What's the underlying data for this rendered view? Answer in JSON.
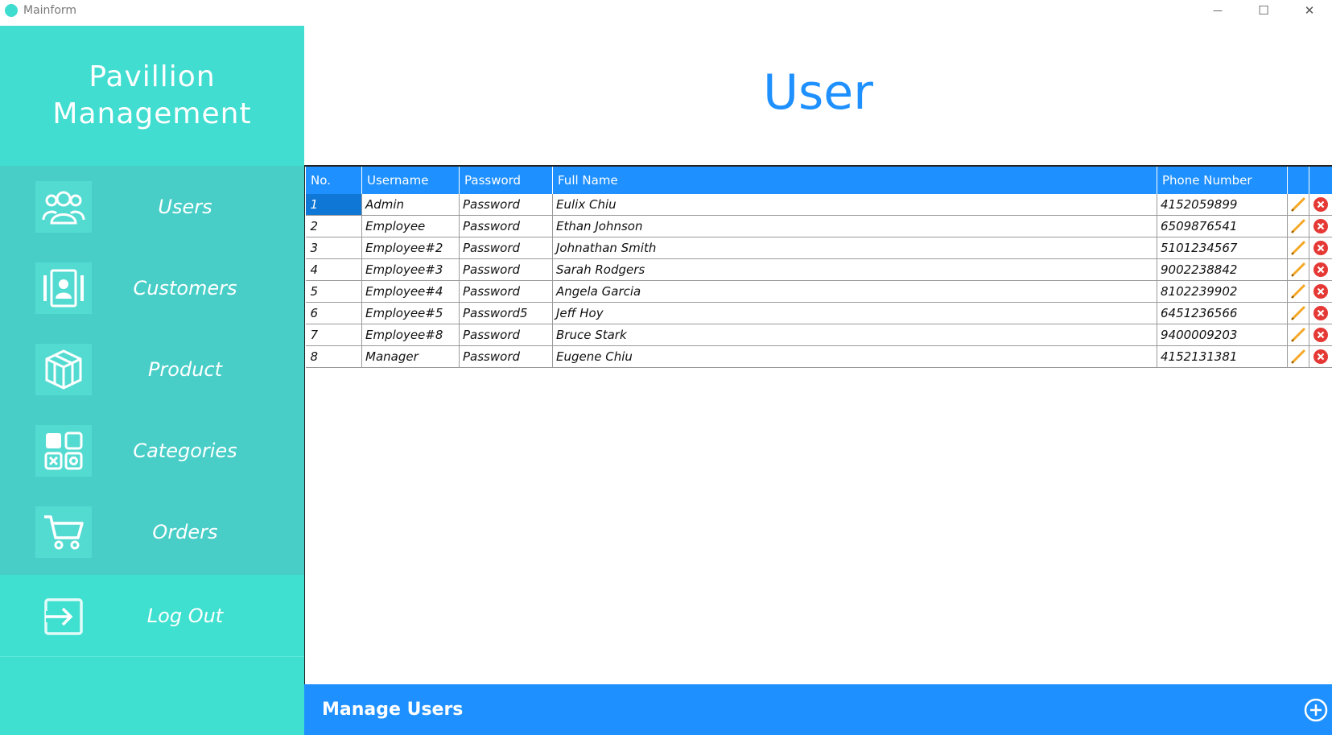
{
  "window": {
    "title": "Mainform",
    "minimize_glyph": "—",
    "maximize_glyph": "☐",
    "close_glyph": "✕"
  },
  "sidebar": {
    "brand_line1": "Pavillion",
    "brand_line2": "Management",
    "items": [
      {
        "label": "Users",
        "icon": "users-icon"
      },
      {
        "label": "Customers",
        "icon": "contact-card-icon"
      },
      {
        "label": "Product",
        "icon": "gift-box-icon"
      },
      {
        "label": "Categories",
        "icon": "categories-icon"
      },
      {
        "label": "Orders",
        "icon": "cart-icon"
      }
    ],
    "logout_label": "Log Out",
    "logout_icon": "logout-icon"
  },
  "main": {
    "title": "User",
    "columns": [
      "No.",
      "Username",
      "Password",
      "Full Name",
      "Phone Number"
    ],
    "rows": [
      {
        "no": "1",
        "username": "Admin",
        "password": "Password",
        "full_name": "Eulix Chiu",
        "phone": "4152059899"
      },
      {
        "no": "2",
        "username": "Employee",
        "password": "Password",
        "full_name": "Ethan Johnson",
        "phone": "6509876541"
      },
      {
        "no": "3",
        "username": "Employee#2",
        "password": "Password",
        "full_name": "Johnathan Smith",
        "phone": "5101234567"
      },
      {
        "no": "4",
        "username": "Employee#3",
        "password": "Password",
        "full_name": "Sarah Rodgers",
        "phone": "9002238842"
      },
      {
        "no": "5",
        "username": "Employee#4",
        "password": "Password",
        "full_name": "Angela Garcia",
        "phone": "8102239902"
      },
      {
        "no": "6",
        "username": "Employee#5",
        "password": "Password5",
        "full_name": "Jeff Hoy",
        "phone": "6451236566"
      },
      {
        "no": "7",
        "username": "Employee#8",
        "password": "Password",
        "full_name": "Bruce Stark",
        "phone": "9400009203"
      },
      {
        "no": "8",
        "username": "Manager",
        "password": "Password",
        "full_name": "Eugene Chiu",
        "phone": "4152131381"
      }
    ],
    "row_actions": [
      "edit-pencil-icon",
      "delete-circle-icon"
    ]
  },
  "footer": {
    "title": "Manage Users",
    "add_icon": "add-circle-icon"
  },
  "colors": {
    "accent": "#1e90ff",
    "sidebar": "#3fe0d0",
    "sidebar_nav": "#48cec7",
    "delete": "#e53935",
    "edit": "#f5a623"
  }
}
